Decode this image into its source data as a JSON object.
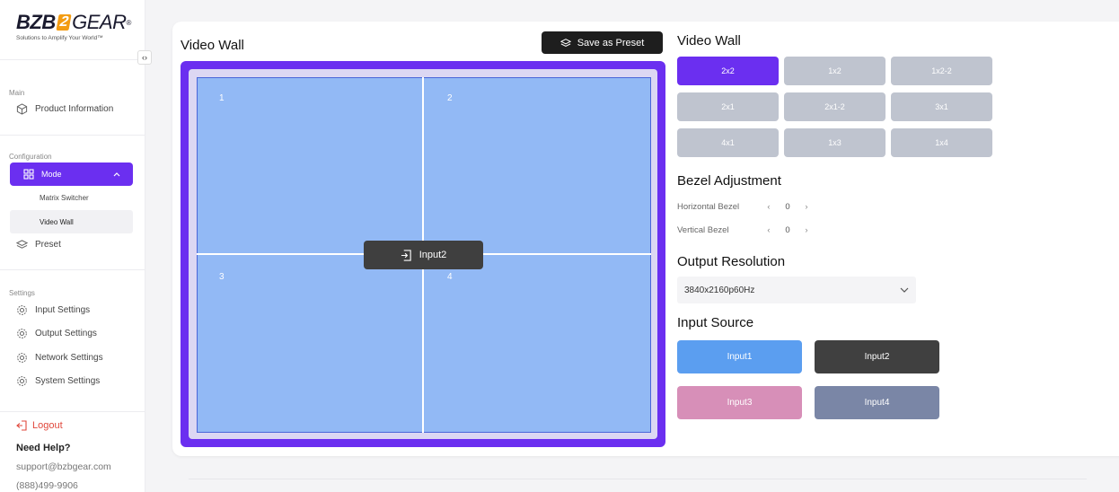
{
  "brand": {
    "part1": "BZB",
    "part2": "2",
    "part3": "GEAR",
    "trademark": "®",
    "tagline": "Solutions to Amplify Your World™"
  },
  "sidebar": {
    "collapse_glyph": "‹›",
    "sections": {
      "main": "Main",
      "configuration": "Configuration",
      "settings": "Settings"
    },
    "items": {
      "product_information": "Product Information",
      "mode": "Mode",
      "matrix_switcher": "Matrix Switcher",
      "video_wall": "Video Wall",
      "preset": "Preset",
      "input_settings": "Input Settings",
      "output_settings": "Output Settings",
      "network_settings": "Network Settings",
      "system_settings": "System Settings"
    },
    "logout": "Logout",
    "help": {
      "title": "Need Help?",
      "email": "support@bzbgear.com",
      "phone": "(888)499-9906"
    }
  },
  "video_wall": {
    "title": "Video Wall",
    "save_preset_label": "Save as Preset",
    "cells": [
      "1",
      "2",
      "3",
      "4"
    ],
    "source_label": "Input2"
  },
  "right_panel": {
    "layout_title": "Video Wall",
    "layouts": [
      "2x2",
      "1x2",
      "1x2-2",
      "2x1",
      "2x1-2",
      "3x1",
      "4x1",
      "1x3",
      "1x4"
    ],
    "active_layout": "2x2",
    "bezel_title": "Bezel Adjustment",
    "horizontal_bezel_label": "Horizontal Bezel",
    "horizontal_bezel_value": "0",
    "vertical_bezel_label": "Vertical Bezel",
    "vertical_bezel_value": "0",
    "resolution_title": "Output Resolution",
    "resolution_value": "3840x2160p60Hz",
    "input_title": "Input Source",
    "inputs": [
      {
        "label": "Input1",
        "color": "#5b9ef0"
      },
      {
        "label": "Input2",
        "color": "#404040"
      },
      {
        "label": "Input3",
        "color": "#d78fb8"
      },
      {
        "label": "Input4",
        "color": "#7a86a6"
      }
    ]
  },
  "colors": {
    "accent": "#6b2ff0",
    "wall_cell": "#92b9f5",
    "logout": "#e0473b"
  }
}
